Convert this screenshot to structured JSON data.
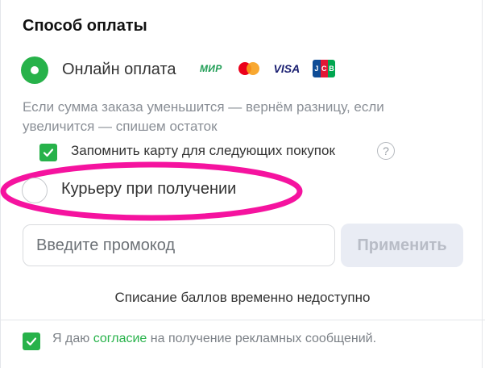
{
  "payment": {
    "title": "Способ оплаты",
    "online_label": "Онлайн оплата",
    "logos": {
      "mir": "МИР",
      "visa": "VISA",
      "jcb": [
        "J",
        "C",
        "B"
      ]
    },
    "info": "Если сумма заказа уменьшится — вернём разницу, если увеличится — спишем остаток",
    "remember_card_label": "Запомнить карту для следующих покупок",
    "help_glyph": "?",
    "courier_label": "Курьеру при получении",
    "selected_method": "online"
  },
  "promo": {
    "placeholder": "Введите промокод",
    "apply_label": "Применить"
  },
  "points_note": "Списание баллов временно недоступно",
  "consent": {
    "prefix": "Я даю ",
    "link": "согласие",
    "suffix": " на получение рекламных сообщений."
  },
  "colors": {
    "accent": "#27b24a",
    "highlight": "#f5139f",
    "button_disabled_bg": "#e9ecf4",
    "muted_text": "#8a8f96"
  },
  "icons": [
    "radio-selected-icon",
    "radio-empty-icon",
    "checkmark-icon",
    "question-circle-icon",
    "mir-logo",
    "mastercard-logo",
    "visa-logo",
    "jcb-logo"
  ]
}
